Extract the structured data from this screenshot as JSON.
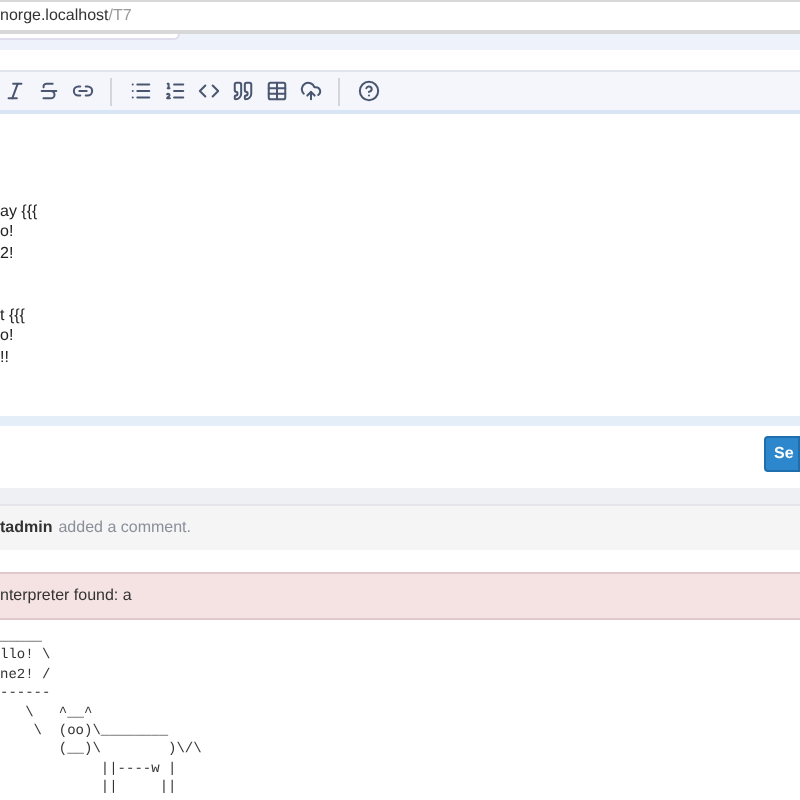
{
  "address_bar": {
    "host": "norge.localhost",
    "path": "/T7"
  },
  "toolbar": [
    {
      "kind": "italic"
    },
    {
      "kind": "strikethrough"
    },
    {
      "kind": "link"
    },
    {
      "kind": "divider"
    },
    {
      "kind": "bullets"
    },
    {
      "kind": "numbers"
    },
    {
      "kind": "code"
    },
    {
      "kind": "quote"
    },
    {
      "kind": "table"
    },
    {
      "kind": "upload"
    },
    {
      "kind": "divider"
    },
    {
      "kind": "help"
    }
  ],
  "editor": {
    "paragraphs": [
      {
        "lines": [
          "ay {{{",
          "o!",
          "2!"
        ]
      },
      {
        "lines": [
          "t {{{",
          "o!",
          "!!"
        ]
      }
    ]
  },
  "send_button": {
    "label": "Se"
  },
  "comment": {
    "author": "tadmin",
    "action": "added a comment."
  },
  "error": {
    "message": "nterpreter found: a"
  },
  "output": {
    "lines": [
      "_____",
      "llo! \\",
      "ne2! /",
      "------",
      "   \\   ^__^",
      "    \\  (oo)\\________",
      "       (__)\\        )\\/\\",
      "            ||----w |",
      "            ||     ||"
    ]
  }
}
